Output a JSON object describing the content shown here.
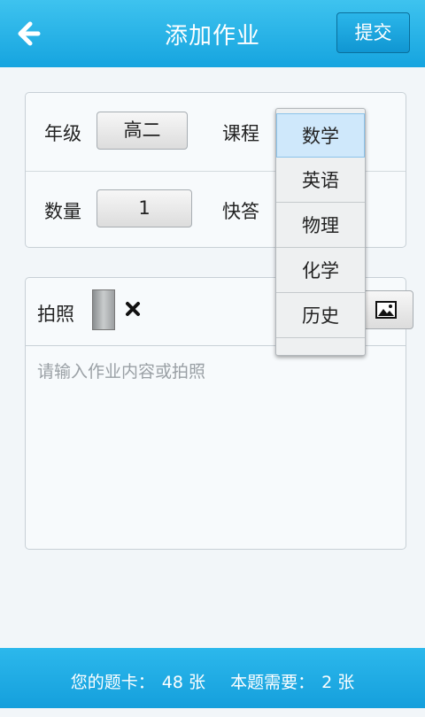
{
  "header": {
    "title": "添加作业",
    "submit_label": "提交",
    "back_icon": "arrow-left-icon"
  },
  "form": {
    "grade_label": "年级",
    "grade_value": "高二",
    "course_label": "课程",
    "quantity_label": "数量",
    "quantity_value": "1",
    "quick_label": "快答"
  },
  "photo": {
    "label": "拍照",
    "remove_icon": "close-icon",
    "gallery_icon": "image-icon"
  },
  "content": {
    "placeholder": "请输入作业内容或拍照"
  },
  "dropdown": {
    "options": [
      "数学",
      "英语",
      "物理",
      "化学",
      "历史",
      ""
    ],
    "selected_index": 0
  },
  "footer": {
    "cards_prefix": "您的题卡：",
    "cards_value": "48 张",
    "needed_prefix": "本题需要：",
    "needed_value": "2 张"
  },
  "colors": {
    "accent": "#1aa7e0",
    "selected_option": "#cfe8fb"
  }
}
